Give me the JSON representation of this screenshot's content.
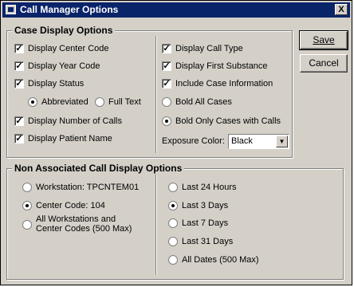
{
  "window": {
    "title": "Call Manager Options",
    "close_glyph": "X",
    "app_icon": "window-app-icon"
  },
  "case_display": {
    "legend": "Case Display Options",
    "left": [
      {
        "label": "Display Center Code",
        "checked": true
      },
      {
        "label": "Display Year Code",
        "checked": true
      },
      {
        "label": "Display Status",
        "checked": true
      }
    ],
    "status_options": [
      {
        "label": "Abbreviated",
        "selected": true
      },
      {
        "label": "Full Text",
        "selected": false
      }
    ],
    "left2": [
      {
        "label": "Display Number of Calls",
        "checked": true
      },
      {
        "label": "Display Patient Name",
        "checked": true
      }
    ],
    "right_checks": [
      {
        "label": "Display Call Type",
        "checked": true
      },
      {
        "label": "Display First Substance",
        "checked": true
      },
      {
        "label": "Include Case Information",
        "checked": true
      }
    ],
    "right_radios": [
      {
        "label": "Bold All Cases",
        "selected": false
      },
      {
        "label": "Bold Only Cases with Calls",
        "selected": true
      }
    ],
    "exposure_label": "Exposure Color:",
    "exposure_value": "Black"
  },
  "non_associated": {
    "legend": "Non Associated Call Display Options",
    "left": [
      {
        "label": "Workstation: TPCNTEM01",
        "selected": false
      },
      {
        "label": "Center Code: 104",
        "selected": true
      },
      {
        "label_line1": "All Workstations and",
        "label_line2": "Center Codes (500 Max)",
        "selected": false
      }
    ],
    "right": [
      {
        "label": "Last 24 Hours",
        "selected": false
      },
      {
        "label": "Last 3 Days",
        "selected": true
      },
      {
        "label": "Last 7 Days",
        "selected": false
      },
      {
        "label": "Last 31 Days",
        "selected": false
      },
      {
        "label": "All Dates (500 Max)",
        "selected": false
      }
    ]
  },
  "buttons": {
    "save": "Save",
    "cancel": "Cancel"
  },
  "check_glyph": "✓"
}
